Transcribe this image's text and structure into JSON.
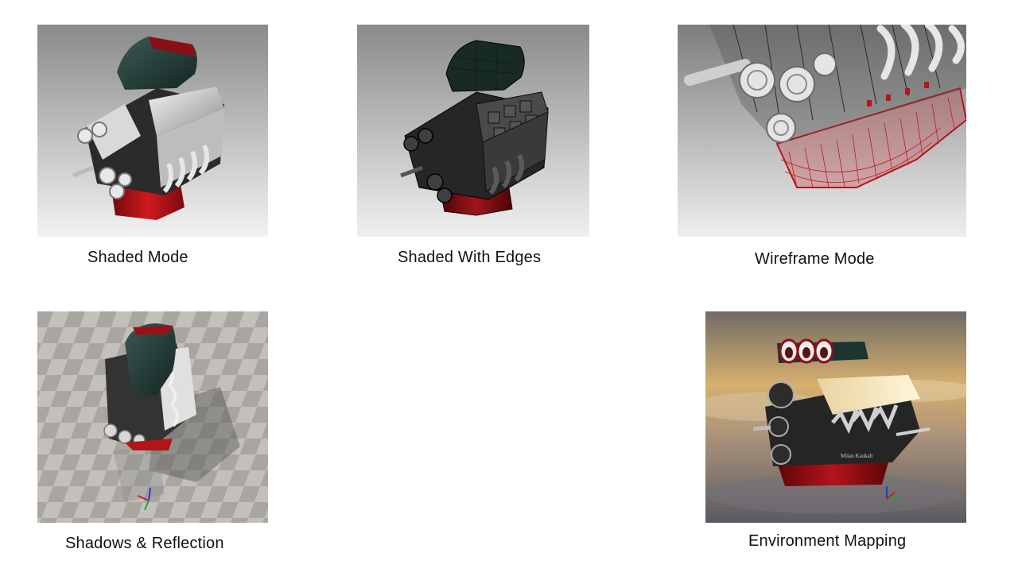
{
  "panels": [
    {
      "id": "shaded",
      "caption": "Shaded Mode"
    },
    {
      "id": "shaded-edges",
      "caption": "Shaded With Edges"
    },
    {
      "id": "wireframe",
      "caption": "Wireframe Mode"
    },
    {
      "id": "shadows",
      "caption": "Shadows & Reflection"
    },
    {
      "id": "environment",
      "caption": "Environment Mapping"
    }
  ],
  "engine_badge": "Milan Kaukab",
  "colors": {
    "engine_red": "#b3141a",
    "hood_green": "#1f3a35",
    "metal": "#c8c8c8",
    "sky": "#c9a36a"
  }
}
